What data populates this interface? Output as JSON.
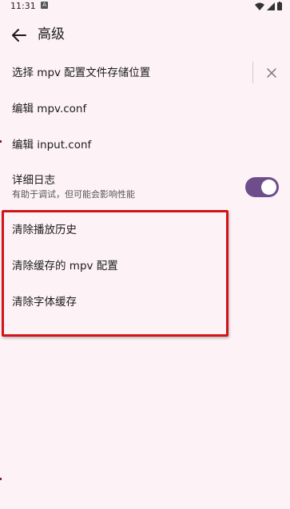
{
  "status": {
    "time": "11:31",
    "notification": "A"
  },
  "app_bar": {
    "title": "高级"
  },
  "settings": {
    "config_location": "选择 mpv 配置文件存储位置",
    "edit_mpv_conf": "编辑 mpv.conf",
    "edit_input_conf": "编辑 input.conf",
    "verbose_log": {
      "label": "详细日志",
      "description": "有助于调试，但可能会影响性能",
      "enabled": true
    },
    "clear_history": "清除播放历史",
    "clear_cached_config": "清除缓存的 mpv 配置",
    "clear_font_cache": "清除字体缓存"
  },
  "colors": {
    "accent": "#6e4d8d",
    "background": "#fdf3f6",
    "highlight": "#d0141b"
  }
}
